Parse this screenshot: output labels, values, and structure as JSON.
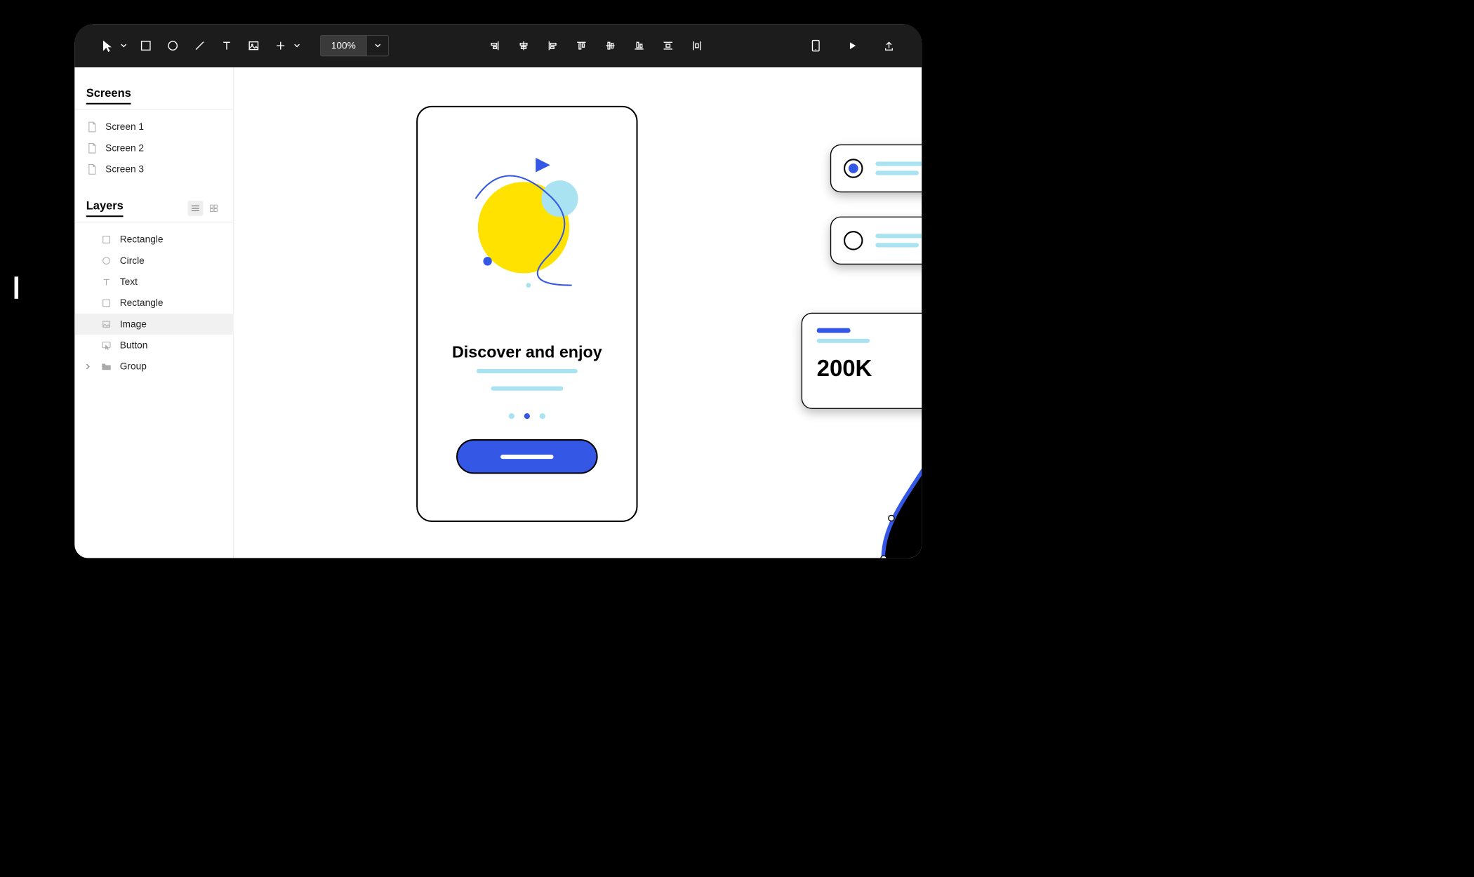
{
  "toolbar": {
    "zoom": "100%"
  },
  "sidebar": {
    "screens_title": "Screens",
    "screens": [
      {
        "label": "Screen 1"
      },
      {
        "label": "Screen 2"
      },
      {
        "label": "Screen 3"
      }
    ],
    "layers_title": "Layers",
    "layers": [
      {
        "label": "Rectangle",
        "icon": "rect",
        "selected": false
      },
      {
        "label": "Circle",
        "icon": "circle",
        "selected": false
      },
      {
        "label": "Text",
        "icon": "text",
        "selected": false
      },
      {
        "label": "Rectangle",
        "icon": "rect",
        "selected": false
      },
      {
        "label": "Image",
        "icon": "image",
        "selected": true
      },
      {
        "label": "Button",
        "icon": "button",
        "selected": false
      },
      {
        "label": "Group",
        "icon": "folder",
        "selected": false,
        "hasChildren": true
      }
    ]
  },
  "canvas": {
    "phone_title": "Discover and enjoy"
  },
  "stat_card": {
    "value": "200K"
  }
}
